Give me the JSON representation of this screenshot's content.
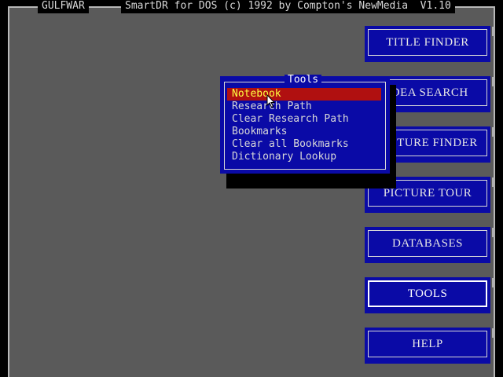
{
  "header": {
    "app_name": "GULFWAR",
    "title": "SmartDR for DOS (c) 1992 by Compton's NewMedia  V1.10"
  },
  "nav_buttons": [
    {
      "label": "TITLE FINDER"
    },
    {
      "label": "IDEA SEARCH"
    },
    {
      "label": "PICTURE FINDER"
    },
    {
      "label": "PICTURE TOUR"
    },
    {
      "label": "DATABASES"
    },
    {
      "label": "TOOLS"
    },
    {
      "label": "HELP"
    }
  ],
  "active_nav": "TOOLS",
  "tools_menu": {
    "title": "Tools",
    "selected": "Notebook",
    "items": [
      {
        "label": "Notebook"
      },
      {
        "label": "Research Path"
      },
      {
        "label": "Clear Research Path"
      },
      {
        "label": "Bookmarks"
      },
      {
        "label": "Clear all Bookmarks"
      },
      {
        "label": "Dictionary Lookup"
      }
    ]
  },
  "colors": {
    "background": "#5a5a5a",
    "button_blue": "#0a0aa6",
    "selection_red": "#b01010",
    "selection_text": "#ffff40"
  }
}
